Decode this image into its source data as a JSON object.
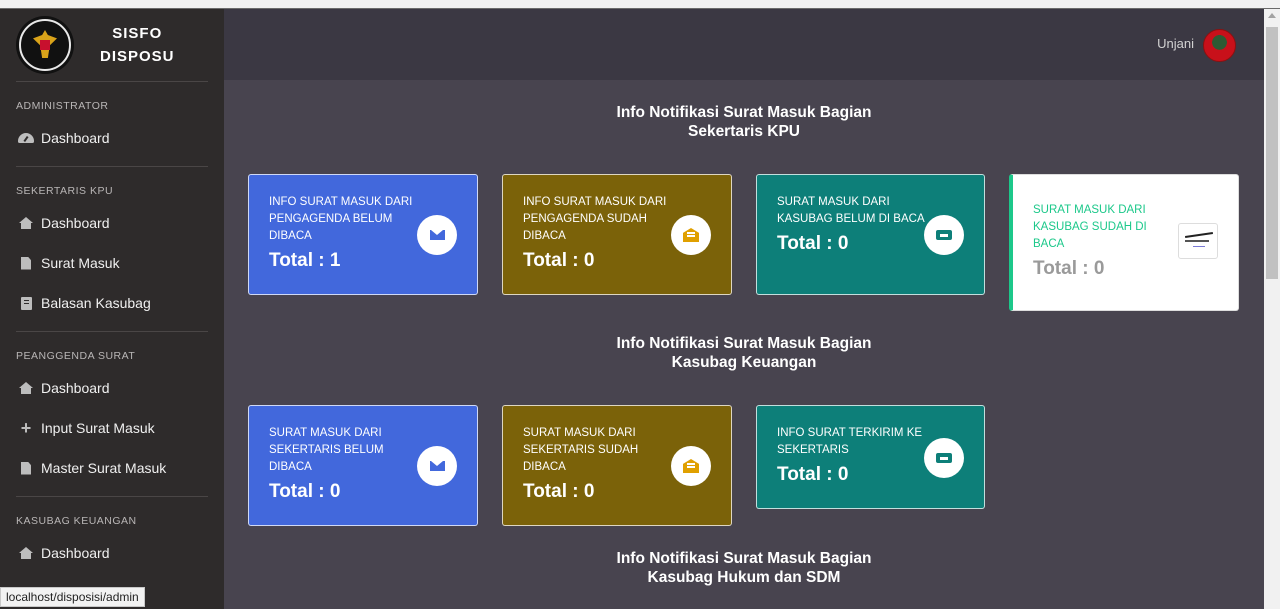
{
  "app": {
    "title_line1": "SISFO",
    "title_line2": "DISPOSU"
  },
  "sidebar": {
    "sections": [
      {
        "heading": "ADMINISTRATOR",
        "items": [
          {
            "label": "Dashboard",
            "icon": "dashboard-gauge-icon"
          }
        ]
      },
      {
        "heading": "SEKERTARIS KPU",
        "items": [
          {
            "label": "Dashboard",
            "icon": "home-icon"
          },
          {
            "label": "Surat Masuk",
            "icon": "file-icon"
          },
          {
            "label": "Balasan Kasubag",
            "icon": "book-icon"
          }
        ]
      },
      {
        "heading": "PEANGGENDA SURAT",
        "items": [
          {
            "label": "Dashboard",
            "icon": "home-icon"
          },
          {
            "label": "Input Surat Masuk",
            "icon": "plus-icon"
          },
          {
            "label": "Master Surat Masuk",
            "icon": "file-icon"
          }
        ]
      },
      {
        "heading": "KASUBAG KEUANGAN",
        "items": [
          {
            "label": "Dashboard",
            "icon": "home-icon"
          }
        ]
      }
    ]
  },
  "topbar": {
    "user_name": "Unjani"
  },
  "sections": [
    {
      "title_line1": "Info Notifikasi Surat Masuk Bagian",
      "title_line2": "Sekertaris KPU"
    },
    {
      "title_line1": "Info Notifikasi Surat Masuk Bagian",
      "title_line2": "Kasubag Keuangan"
    },
    {
      "title_line1": "Info Notifikasi Surat Masuk Bagian",
      "title_line2": "Kasubag Hukum dan SDM"
    }
  ],
  "cards": {
    "row1": [
      {
        "label": "INFO SURAT MASUK DARI PENGAGENDA BELUM DIBACA",
        "total": "Total : 1",
        "icon": "envelope-icon",
        "color": "#4268dc"
      },
      {
        "label": "INFO SURAT MASUK DARI PENGAGENDA SUDAH DIBACA",
        "total": "Total : 0",
        "icon": "envelope-open-icon",
        "color": "#7b6209"
      },
      {
        "label": "SURAT MASUK DARI KASUBAG BELUM DI BACA",
        "total": "Total : 0",
        "icon": "inbox-icon",
        "color": "#0d7f79"
      },
      {
        "label": "SURAT MASUK DARI KASUBAG SUDAH DI BACA",
        "total": "Total : 0",
        "icon": "document-thumbnail-icon",
        "color": "#1cc88a"
      }
    ],
    "row2": [
      {
        "label": "SURAT MASUK DARI SEKERTARIS BELUM DIBACA",
        "total": "Total : 0",
        "icon": "envelope-icon",
        "color": "#4268dc"
      },
      {
        "label": "SURAT MASUK DARI SEKERTARIS SUDAH DIBACA",
        "total": "Total : 0",
        "icon": "envelope-open-icon",
        "color": "#7b6209"
      },
      {
        "label": "INFO SURAT TERKIRIM KE SEKERTARIS",
        "total": "Total : 0",
        "icon": "inbox-icon",
        "color": "#0d7f79"
      }
    ]
  },
  "status_bar": {
    "url": "localhost/disposisi/admin"
  }
}
